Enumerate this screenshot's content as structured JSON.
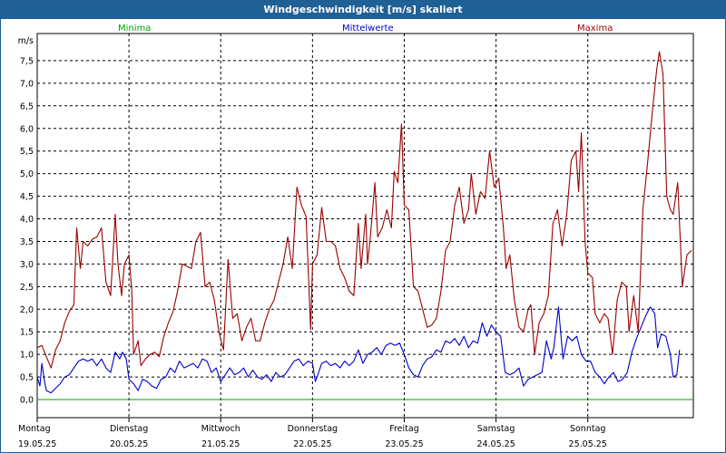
{
  "window": {
    "title": "Windgeschwindigkeit [m/s] skaliert"
  },
  "legend": {
    "minima": "Minima",
    "mittelwerte": "Mittelwerte",
    "maxima": "Maxima"
  },
  "colors": {
    "minima": "#00a000",
    "mittelwerte": "#0000cc",
    "maxima": "#990000",
    "titlebar": "#1f6096"
  },
  "chart_data": {
    "type": "line",
    "title": "Windgeschwindigkeit [m/s] skaliert",
    "ylabel": "m/s",
    "ylim": [
      -0.4,
      8.1
    ],
    "yticks": [
      "0,0",
      "0,5",
      "1,0",
      "1,5",
      "2,0",
      "2,5",
      "3,0",
      "3,5",
      "4,0",
      "4,5",
      "5,0",
      "5,5",
      "6,0",
      "6,5",
      "7,0",
      "7,5"
    ],
    "xlim": [
      0,
      7.15
    ],
    "grid": true,
    "legend_position": "top",
    "days": [
      {
        "name": "Montag",
        "date": "19.05.25"
      },
      {
        "name": "Dienstag",
        "date": "20.05.25"
      },
      {
        "name": "Mittwoch",
        "date": "21.05.25"
      },
      {
        "name": "Donnerstag",
        "date": "22.05.25"
      },
      {
        "name": "Freitag",
        "date": "23.05.25"
      },
      {
        "name": "Samstag",
        "date": "24.05.25"
      },
      {
        "name": "Sonntag",
        "date": "25.05.25"
      }
    ],
    "series": [
      {
        "name": "Minima",
        "points": [
          [
            0.0,
            0.0
          ],
          [
            7.15,
            0.0
          ]
        ]
      },
      {
        "name": "Mittelwerte",
        "points": [
          [
            0.0,
            0.5
          ],
          [
            0.03,
            0.3
          ],
          [
            0.05,
            0.8
          ],
          [
            0.08,
            0.4
          ],
          [
            0.1,
            0.2
          ],
          [
            0.15,
            0.15
          ],
          [
            0.2,
            0.25
          ],
          [
            0.25,
            0.35
          ],
          [
            0.3,
            0.5
          ],
          [
            0.35,
            0.55
          ],
          [
            0.4,
            0.7
          ],
          [
            0.45,
            0.85
          ],
          [
            0.5,
            0.9
          ],
          [
            0.55,
            0.85
          ],
          [
            0.6,
            0.9
          ],
          [
            0.65,
            0.75
          ],
          [
            0.7,
            0.9
          ],
          [
            0.75,
            0.7
          ],
          [
            0.8,
            0.6
          ],
          [
            0.85,
            1.05
          ],
          [
            0.9,
            0.9
          ],
          [
            0.93,
            1.05
          ],
          [
            0.97,
            0.9
          ],
          [
            1.0,
            0.45
          ],
          [
            1.05,
            0.35
          ],
          [
            1.1,
            0.2
          ],
          [
            1.15,
            0.45
          ],
          [
            1.2,
            0.4
          ],
          [
            1.25,
            0.3
          ],
          [
            1.3,
            0.25
          ],
          [
            1.35,
            0.45
          ],
          [
            1.4,
            0.5
          ],
          [
            1.45,
            0.7
          ],
          [
            1.5,
            0.6
          ],
          [
            1.55,
            0.85
          ],
          [
            1.6,
            0.7
          ],
          [
            1.65,
            0.75
          ],
          [
            1.7,
            0.8
          ],
          [
            1.75,
            0.7
          ],
          [
            1.8,
            0.9
          ],
          [
            1.85,
            0.85
          ],
          [
            1.9,
            0.6
          ],
          [
            1.95,
            0.7
          ],
          [
            2.0,
            0.4
          ],
          [
            2.05,
            0.55
          ],
          [
            2.1,
            0.7
          ],
          [
            2.15,
            0.55
          ],
          [
            2.2,
            0.6
          ],
          [
            2.25,
            0.7
          ],
          [
            2.3,
            0.5
          ],
          [
            2.35,
            0.65
          ],
          [
            2.4,
            0.5
          ],
          [
            2.45,
            0.45
          ],
          [
            2.5,
            0.55
          ],
          [
            2.55,
            0.4
          ],
          [
            2.6,
            0.6
          ],
          [
            2.65,
            0.5
          ],
          [
            2.7,
            0.55
          ],
          [
            2.75,
            0.7
          ],
          [
            2.8,
            0.85
          ],
          [
            2.85,
            0.9
          ],
          [
            2.9,
            0.75
          ],
          [
            2.95,
            0.85
          ],
          [
            3.0,
            0.8
          ],
          [
            3.03,
            0.4
          ],
          [
            3.05,
            0.5
          ],
          [
            3.1,
            0.8
          ],
          [
            3.15,
            0.85
          ],
          [
            3.2,
            0.75
          ],
          [
            3.25,
            0.8
          ],
          [
            3.3,
            0.7
          ],
          [
            3.35,
            0.85
          ],
          [
            3.4,
            0.75
          ],
          [
            3.45,
            0.85
          ],
          [
            3.5,
            1.1
          ],
          [
            3.55,
            0.8
          ],
          [
            3.6,
            1.0
          ],
          [
            3.65,
            1.05
          ],
          [
            3.7,
            1.15
          ],
          [
            3.75,
            1.0
          ],
          [
            3.8,
            1.2
          ],
          [
            3.85,
            1.25
          ],
          [
            3.9,
            1.2
          ],
          [
            3.95,
            1.25
          ],
          [
            4.0,
            1.0
          ],
          [
            4.05,
            0.7
          ],
          [
            4.1,
            0.55
          ],
          [
            4.15,
            0.5
          ],
          [
            4.2,
            0.75
          ],
          [
            4.25,
            0.9
          ],
          [
            4.3,
            0.95
          ],
          [
            4.35,
            1.1
          ],
          [
            4.4,
            1.05
          ],
          [
            4.45,
            1.3
          ],
          [
            4.5,
            1.25
          ],
          [
            4.55,
            1.35
          ],
          [
            4.6,
            1.2
          ],
          [
            4.65,
            1.4
          ],
          [
            4.7,
            1.15
          ],
          [
            4.75,
            1.3
          ],
          [
            4.8,
            1.25
          ],
          [
            4.85,
            1.7
          ],
          [
            4.9,
            1.4
          ],
          [
            4.95,
            1.65
          ],
          [
            5.0,
            1.5
          ],
          [
            5.05,
            1.4
          ],
          [
            5.1,
            0.6
          ],
          [
            5.15,
            0.55
          ],
          [
            5.2,
            0.6
          ],
          [
            5.25,
            0.7
          ],
          [
            5.3,
            0.3
          ],
          [
            5.35,
            0.45
          ],
          [
            5.4,
            0.5
          ],
          [
            5.45,
            0.55
          ],
          [
            5.5,
            0.6
          ],
          [
            5.55,
            1.3
          ],
          [
            5.6,
            0.9
          ],
          [
            5.63,
            1.15
          ],
          [
            5.68,
            2.05
          ],
          [
            5.73,
            0.9
          ],
          [
            5.78,
            1.4
          ],
          [
            5.83,
            1.3
          ],
          [
            5.88,
            1.4
          ],
          [
            5.93,
            1.0
          ],
          [
            5.98,
            0.85
          ],
          [
            6.03,
            0.85
          ],
          [
            6.08,
            0.6
          ],
          [
            6.13,
            0.5
          ],
          [
            6.18,
            0.35
          ],
          [
            6.23,
            0.5
          ],
          [
            6.28,
            0.6
          ],
          [
            6.33,
            0.4
          ],
          [
            6.38,
            0.45
          ],
          [
            6.43,
            0.6
          ],
          [
            6.48,
            1.05
          ],
          [
            6.53,
            1.35
          ],
          [
            6.58,
            1.6
          ],
          [
            6.63,
            1.85
          ],
          [
            6.68,
            2.05
          ],
          [
            6.73,
            1.9
          ],
          [
            6.76,
            1.15
          ],
          [
            6.8,
            1.45
          ],
          [
            6.85,
            1.4
          ],
          [
            6.9,
            1.0
          ],
          [
            6.93,
            0.5
          ],
          [
            6.97,
            0.55
          ],
          [
            7.0,
            1.1
          ]
        ]
      },
      {
        "name": "Maxima",
        "points": [
          [
            0.0,
            1.15
          ],
          [
            0.05,
            1.2
          ],
          [
            0.1,
            0.95
          ],
          [
            0.15,
            0.7
          ],
          [
            0.2,
            1.1
          ],
          [
            0.25,
            1.3
          ],
          [
            0.3,
            1.7
          ],
          [
            0.35,
            1.95
          ],
          [
            0.4,
            2.1
          ],
          [
            0.43,
            3.8
          ],
          [
            0.47,
            2.9
          ],
          [
            0.5,
            3.5
          ],
          [
            0.55,
            3.4
          ],
          [
            0.6,
            3.55
          ],
          [
            0.65,
            3.6
          ],
          [
            0.7,
            3.8
          ],
          [
            0.75,
            2.6
          ],
          [
            0.8,
            2.3
          ],
          [
            0.85,
            4.1
          ],
          [
            0.88,
            3.0
          ],
          [
            0.92,
            2.3
          ],
          [
            0.95,
            3.0
          ],
          [
            1.0,
            3.2
          ],
          [
            1.03,
            2.4
          ],
          [
            1.05,
            1.0
          ],
          [
            1.1,
            1.3
          ],
          [
            1.13,
            0.75
          ],
          [
            1.18,
            0.9
          ],
          [
            1.23,
            1.0
          ],
          [
            1.28,
            1.05
          ],
          [
            1.33,
            0.95
          ],
          [
            1.38,
            1.4
          ],
          [
            1.43,
            1.7
          ],
          [
            1.48,
            1.95
          ],
          [
            1.53,
            2.4
          ],
          [
            1.58,
            3.0
          ],
          [
            1.63,
            2.95
          ],
          [
            1.68,
            2.9
          ],
          [
            1.73,
            3.5
          ],
          [
            1.78,
            3.7
          ],
          [
            1.83,
            2.5
          ],
          [
            1.88,
            2.6
          ],
          [
            1.93,
            2.2
          ],
          [
            1.98,
            1.5
          ],
          [
            2.03,
            1.1
          ],
          [
            2.08,
            3.1
          ],
          [
            2.13,
            1.8
          ],
          [
            2.18,
            1.9
          ],
          [
            2.23,
            1.3
          ],
          [
            2.28,
            1.6
          ],
          [
            2.33,
            1.8
          ],
          [
            2.38,
            1.3
          ],
          [
            2.43,
            1.3
          ],
          [
            2.48,
            1.7
          ],
          [
            2.53,
            2.0
          ],
          [
            2.58,
            2.2
          ],
          [
            2.63,
            2.6
          ],
          [
            2.68,
            3.0
          ],
          [
            2.73,
            3.6
          ],
          [
            2.78,
            2.9
          ],
          [
            2.83,
            4.7
          ],
          [
            2.88,
            4.3
          ],
          [
            2.93,
            4.05
          ],
          [
            2.98,
            1.55
          ],
          [
            3.0,
            3.0
          ],
          [
            3.05,
            3.2
          ],
          [
            3.1,
            4.25
          ],
          [
            3.15,
            3.5
          ],
          [
            3.2,
            3.5
          ],
          [
            3.25,
            3.4
          ],
          [
            3.3,
            2.9
          ],
          [
            3.35,
            2.7
          ],
          [
            3.4,
            2.4
          ],
          [
            3.45,
            2.3
          ],
          [
            3.5,
            3.9
          ],
          [
            3.53,
            2.9
          ],
          [
            3.58,
            4.1
          ],
          [
            3.6,
            3.0
          ],
          [
            3.63,
            3.6
          ],
          [
            3.68,
            4.8
          ],
          [
            3.71,
            3.6
          ],
          [
            3.76,
            3.8
          ],
          [
            3.81,
            4.2
          ],
          [
            3.86,
            3.8
          ],
          [
            3.89,
            5.05
          ],
          [
            3.93,
            4.8
          ],
          [
            3.97,
            6.1
          ],
          [
            4.0,
            4.3
          ],
          [
            4.05,
            4.2
          ],
          [
            4.1,
            2.5
          ],
          [
            4.15,
            2.4
          ],
          [
            4.2,
            2.0
          ],
          [
            4.25,
            1.6
          ],
          [
            4.3,
            1.65
          ],
          [
            4.35,
            1.8
          ],
          [
            4.4,
            2.4
          ],
          [
            4.45,
            3.3
          ],
          [
            4.5,
            3.5
          ],
          [
            4.55,
            4.3
          ],
          [
            4.6,
            4.7
          ],
          [
            4.65,
            3.9
          ],
          [
            4.7,
            4.2
          ],
          [
            4.73,
            5.0
          ],
          [
            4.78,
            4.1
          ],
          [
            4.83,
            4.6
          ],
          [
            4.88,
            4.45
          ],
          [
            4.93,
            5.5
          ],
          [
            4.98,
            4.7
          ],
          [
            5.03,
            4.9
          ],
          [
            5.08,
            3.8
          ],
          [
            5.11,
            2.9
          ],
          [
            5.15,
            3.2
          ],
          [
            5.2,
            2.2
          ],
          [
            5.25,
            1.6
          ],
          [
            5.3,
            1.5
          ],
          [
            5.35,
            2.0
          ],
          [
            5.38,
            2.1
          ],
          [
            5.42,
            1.0
          ],
          [
            5.47,
            1.7
          ],
          [
            5.52,
            1.9
          ],
          [
            5.57,
            2.3
          ],
          [
            5.62,
            3.9
          ],
          [
            5.67,
            4.2
          ],
          [
            5.72,
            3.4
          ],
          [
            5.77,
            4.1
          ],
          [
            5.82,
            5.3
          ],
          [
            5.87,
            5.5
          ],
          [
            5.9,
            4.6
          ],
          [
            5.93,
            5.9
          ],
          [
            5.97,
            3.5
          ],
          [
            6.0,
            2.8
          ],
          [
            6.05,
            2.7
          ],
          [
            6.08,
            1.9
          ],
          [
            6.13,
            1.7
          ],
          [
            6.18,
            1.9
          ],
          [
            6.22,
            1.8
          ],
          [
            6.27,
            1.0
          ],
          [
            6.32,
            2.2
          ],
          [
            6.37,
            2.6
          ],
          [
            6.42,
            2.5
          ],
          [
            6.45,
            1.5
          ],
          [
            6.5,
            2.3
          ],
          [
            6.55,
            1.5
          ],
          [
            6.6,
            4.2
          ],
          [
            6.65,
            5.2
          ],
          [
            6.7,
            6.3
          ],
          [
            6.75,
            7.3
          ],
          [
            6.78,
            7.7
          ],
          [
            6.82,
            7.2
          ],
          [
            6.86,
            4.5
          ],
          [
            6.9,
            4.2
          ],
          [
            6.93,
            4.1
          ],
          [
            6.98,
            4.8
          ],
          [
            7.03,
            2.5
          ],
          [
            7.08,
            3.2
          ],
          [
            7.13,
            3.3
          ]
        ]
      }
    ]
  }
}
